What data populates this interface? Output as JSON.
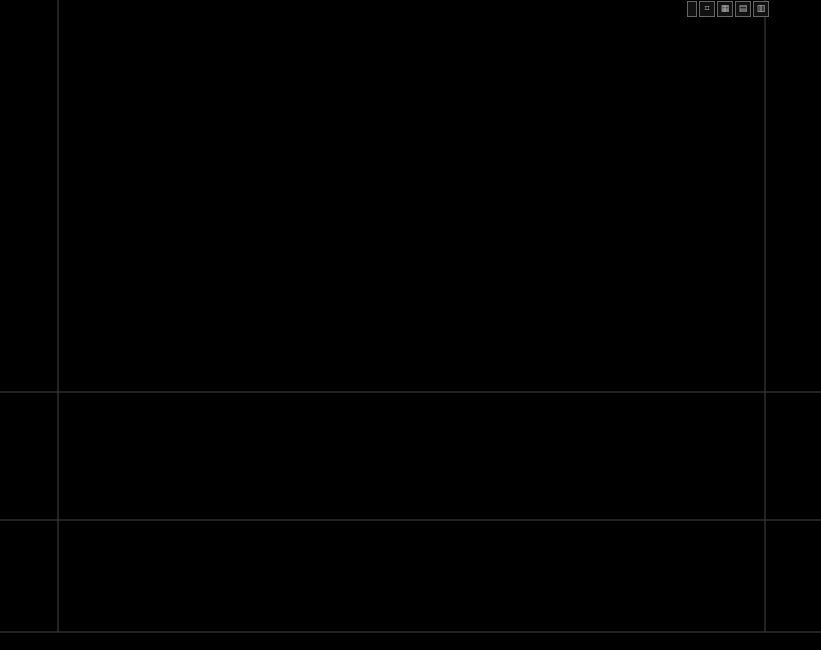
{
  "panel_titles": {
    "price": "",
    "macd": "",
    "kdj": ""
  },
  "toolbar": {
    "theme": ""
  },
  "bottom_label": "",
  "watermark": "",
  "colors": {
    "up": "#ff3232",
    "down": "#2fd47a",
    "macd_line": "#ffffff",
    "dea_line": "#ffff33",
    "kdj_j": "#ff33ff"
  },
  "chart_data": []
}
